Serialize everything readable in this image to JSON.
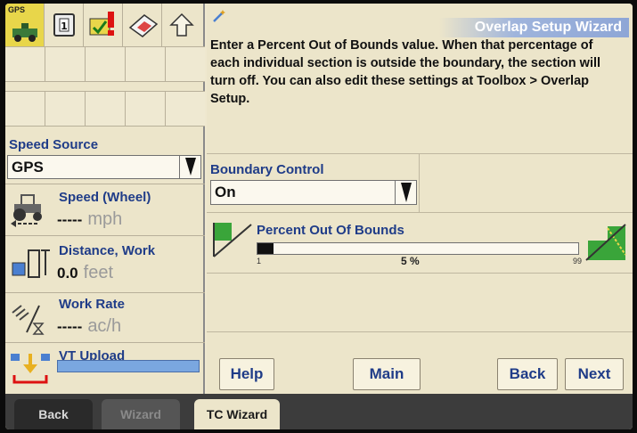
{
  "toolbar": {
    "gps_label": "GPS",
    "icons": [
      "gps-antenna-icon",
      "page-one-icon",
      "alarm-warning-icon",
      "screenshot-card-icon",
      "up-arrow-icon"
    ]
  },
  "left": {
    "speed_source_title": "Speed Source",
    "speed_source_value": "GPS",
    "speed": {
      "label": "Speed (Wheel)",
      "value": "-----",
      "unit": "mph"
    },
    "distance": {
      "label": "Distance, Work",
      "value": "0.0",
      "unit": "feet"
    },
    "work_rate": {
      "label": "Work Rate",
      "value": "-----",
      "unit": "ac/h"
    },
    "vt_upload": {
      "label": "VT Upload"
    }
  },
  "wizard": {
    "title": "Overlap Setup Wizard",
    "instructions": "Enter a Percent Out of Bounds value. When that percentage of each individual section is outside the boundary, the section will turn off. You can also edit these settings at Toolbox > Overlap Setup.",
    "boundary_control_label": "Boundary Control",
    "boundary_control_value": "On",
    "percent_out_label": "Percent Out Of Bounds",
    "slider_min": "1",
    "slider_max": "99",
    "slider_value": "5 %",
    "slider_fraction": 0.05
  },
  "buttons": {
    "help": "Help",
    "main": "Main",
    "back": "Back",
    "next": "Next"
  },
  "tabs": {
    "back": "Back",
    "wizard": "Wizard",
    "tc_wizard": "TC Wizard"
  },
  "colors": {
    "label_blue": "#1f3c88",
    "gps_yellow": "#e8d64a",
    "upload_blue": "#7aa7e0",
    "tab_bg": "#3c3c3c"
  }
}
